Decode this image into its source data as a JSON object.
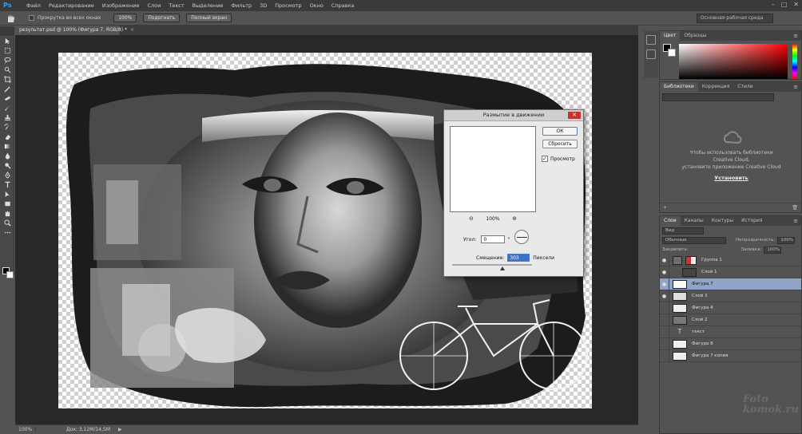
{
  "menu": {
    "logo": "Ps",
    "items": [
      "Файл",
      "Редактирование",
      "Изображение",
      "Слои",
      "Текст",
      "Выделение",
      "Фильтр",
      "3D",
      "Просмотр",
      "Окно",
      "Справка"
    ],
    "window_controls": [
      "–",
      "□",
      "✕"
    ]
  },
  "options": {
    "scroll_all": "Прокрутка во всех окнах",
    "zoom_btn": "100%",
    "fit_btn": "Подогнать",
    "fullscreen_btn": "Полный экран",
    "workspace": "Основная рабочая среда"
  },
  "document": {
    "tab_title": "результат.psd @ 100% (Фигура 7, RGB/8) *",
    "tab_close": "×"
  },
  "status": {
    "zoom": "100%",
    "doc_info": "Док: 3,12M/14,5M",
    "arrow": "▶"
  },
  "dialog": {
    "title": "Размытие в движении",
    "close": "✕",
    "ok": "ОК",
    "reset": "Сбросить",
    "preview_label": "Просмотр",
    "preview_checked": "✓",
    "zoom_out": "⊖",
    "zoom_level": "100%",
    "zoom_in": "⊕",
    "angle_label": "Угол:",
    "angle_value": "0",
    "angle_unit": "°",
    "distance_label": "Смещение:",
    "distance_value": "303",
    "distance_unit": "Пиксели"
  },
  "color_panel": {
    "tabs": [
      "Цвет",
      "Образцы"
    ],
    "menu": "≡"
  },
  "library_panel": {
    "tabs": [
      "Библиотеки",
      "Коррекция",
      "Стили"
    ],
    "menu": "≡",
    "message_line1": "Чтобы использовать библиотеки",
    "message_line2": "Creative Cloud,",
    "message_line3": "установите приложение Creative Cloud",
    "install": "Установить"
  },
  "layers_panel": {
    "tabs": [
      "Слои",
      "Каналы",
      "Контуры",
      "История"
    ],
    "menu": "≡",
    "filter": "Вид",
    "blend_mode": "Обычные",
    "opacity_label": "Непрозрачность:",
    "opacity_value": "100%",
    "lock_label": "Закрепить:",
    "fill_label": "Заливка:",
    "fill_value": "100%",
    "layers": [
      {
        "name": "Группа 1",
        "visible": true,
        "selected": false
      },
      {
        "name": "Слой 1",
        "visible": true,
        "selected": false
      },
      {
        "name": "Фигура 7",
        "visible": true,
        "selected": true
      },
      {
        "name": "Слой 3",
        "visible": true,
        "selected": false
      },
      {
        "name": "Фигура 4",
        "visible": false,
        "selected": false
      },
      {
        "name": "Слой 2",
        "visible": false,
        "selected": false
      },
      {
        "name": "текст",
        "visible": false,
        "selected": false
      },
      {
        "name": "Фигура 8",
        "visible": false,
        "selected": false
      },
      {
        "name": "Фигура 7 копия",
        "visible": false,
        "selected": false
      }
    ]
  },
  "watermark": {
    "line1": "Foto",
    "line2": "komok.ru"
  }
}
